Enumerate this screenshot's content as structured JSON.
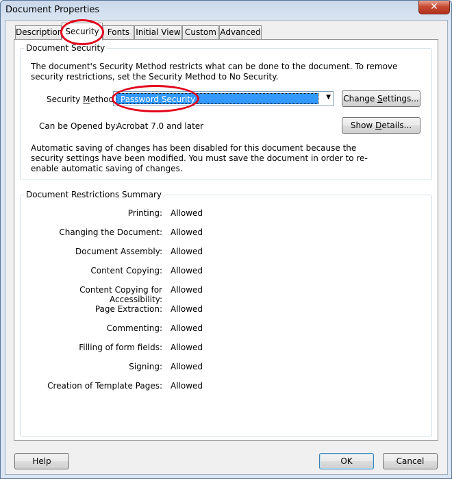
{
  "window": {
    "title": "Document Properties",
    "close_glyph": "✕"
  },
  "tabs": [
    {
      "label": "Description"
    },
    {
      "label": "Security"
    },
    {
      "label": "Fonts"
    },
    {
      "label": "Initial View"
    },
    {
      "label": "Custom"
    },
    {
      "label": "Advanced"
    }
  ],
  "active_tab": "Security",
  "document_security": {
    "group_label": "Document Security",
    "intro_text": "The document's Security Method restricts what can be done to the document. To remove security restrictions, set the Security Method to No Security.",
    "security_method_label_pre": "Security ",
    "security_method_label_u": "M",
    "security_method_label_post": "ethod:",
    "security_method_value": "Password Security",
    "change_settings_pre": "Change ",
    "change_settings_u": "S",
    "change_settings_post": "ettings...",
    "can_be_opened_label": "Can be Opened by:",
    "can_be_opened_value": "Acrobat 7.0 and later",
    "show_details_pre": "Show ",
    "show_details_u": "D",
    "show_details_post": "etails...",
    "autosave_text": "Automatic saving of changes has been disabled for this document because the security settings have been modified. You must save the document in order to re-enable automatic saving of changes."
  },
  "restrictions": {
    "group_label": "Document Restrictions Summary",
    "rows": [
      {
        "label": "Printing:",
        "value": "Allowed"
      },
      {
        "label": "Changing the Document:",
        "value": "Allowed"
      },
      {
        "label": "Document Assembly:",
        "value": "Allowed"
      },
      {
        "label": "Content Copying:",
        "value": "Allowed"
      },
      {
        "label": "Content Copying for Accessibility:",
        "value": "Allowed"
      },
      {
        "label": "Page Extraction:",
        "value": "Allowed"
      },
      {
        "label": "Commenting:",
        "value": "Allowed"
      },
      {
        "label": "Filling of form fields:",
        "value": "Allowed"
      },
      {
        "label": "Signing:",
        "value": "Allowed"
      },
      {
        "label": "Creation of Template Pages:",
        "value": "Allowed"
      }
    ]
  },
  "footer": {
    "help_label": "Help",
    "ok_label": "OK",
    "cancel_label": "Cancel"
  },
  "colors": {
    "annotation_red": "#e3001b",
    "selection_blue": "#3399ff"
  }
}
